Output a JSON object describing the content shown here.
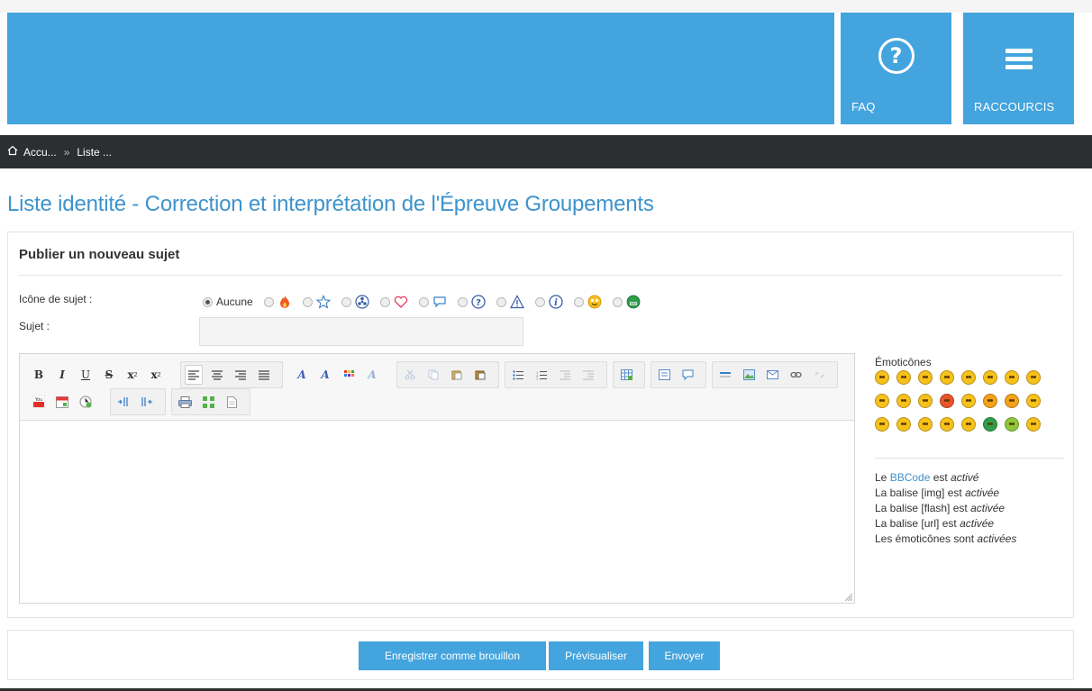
{
  "header": {
    "faq_label": "FAQ",
    "shortcuts_label": "RACCOURCIS",
    "faq_icon_glyph": "?",
    "accent_color": "#44a4dd"
  },
  "breadcrumb": {
    "home_label": "Accu...",
    "separator": "»",
    "current_label": "Liste ..."
  },
  "page": {
    "title": "Liste identité - Correction et interprétation de l'Épreuve Groupements"
  },
  "form": {
    "heading": "Publier un nouveau sujet",
    "topic_icon_label": "Icône de sujet :",
    "topic_icon_none": "Aucune",
    "topic_icons": [
      "fire-icon",
      "star-icon",
      "radioactive-icon",
      "heart-icon",
      "speech-bubble-icon",
      "question-icon",
      "warning-icon",
      "info-icon",
      "smiley-icon",
      "grin-icon"
    ],
    "subject_label": "Sujet :",
    "subject_value": ""
  },
  "smilies": {
    "title": "Émoticônes",
    "rows": [
      [
        "#f7c11c",
        "#f7c11c",
        "#f7c11c",
        "#f7c11c",
        "#f7c11c",
        "#f7c11c",
        "#f7c11c",
        "#f7c11c"
      ],
      [
        "#f7c11c",
        "#f7c11c",
        "#f7c11c",
        "#e8542a",
        "#f7c11c",
        "#f3a21a",
        "#f3a21a",
        "#f7c11c"
      ],
      [
        "#f7c11c",
        "#f7c11c",
        "#f7c11c",
        "#f7c11c",
        "#f7c11c",
        "#2f9e4a",
        "#8fc63a",
        "#f7c11c"
      ]
    ]
  },
  "bbinfo": {
    "line1_prefix": "Le ",
    "line1_link": "BBCode",
    "line1_mid": " est ",
    "line1_state": "activé",
    "line2_prefix": "La balise [img] est ",
    "line2_state": "activée",
    "line3_prefix": "La balise [flash] est ",
    "line3_state": "activée",
    "line4_prefix": "La balise [url] est ",
    "line4_state": "activée",
    "line5_prefix": "Les émoticônes sont ",
    "line5_state": "activées"
  },
  "buttons": {
    "draft": "Enregistrer comme brouillon",
    "preview": "Prévisualiser",
    "send": "Envoyer"
  },
  "toolbar": {
    "bold": "B",
    "italic": "I",
    "underline": "U",
    "strike": "S",
    "subscript": "x",
    "superscript": "x"
  }
}
